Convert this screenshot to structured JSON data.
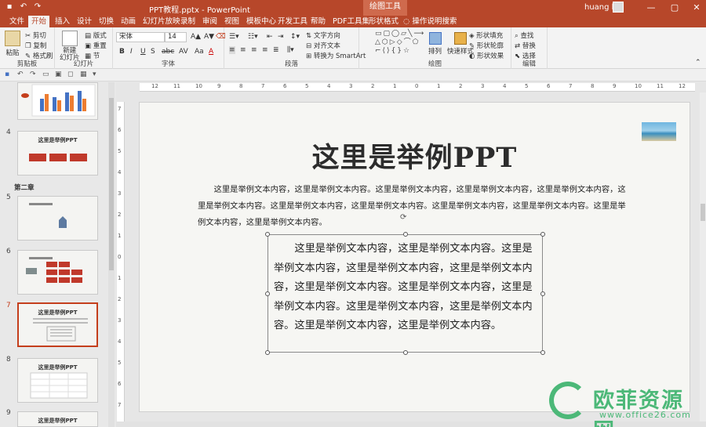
{
  "titlebar": {
    "doc_title": "PPT教程.pptx - PowerPoint",
    "context_group": "绘图工具",
    "user": "huang bo",
    "minimize": "—",
    "restore": "▢",
    "close": "✕"
  },
  "tabs": [
    "文件",
    "开始",
    "插入",
    "设计",
    "切换",
    "动画",
    "幻灯片放映",
    "录制",
    "审阅",
    "视图",
    "模板中心",
    "开发工具",
    "帮助",
    "PDF工具集",
    "形状格式"
  ],
  "tell_me": "操作说明搜索",
  "ribbon": {
    "clipboard": {
      "label": "剪贴板",
      "paste": "粘贴",
      "cut": "剪切",
      "copy": "复制",
      "format_painter": "格式刷"
    },
    "slides": {
      "label": "幻灯片",
      "new_slide": "新建\n幻灯片",
      "layout": "版式",
      "reset": "重置",
      "section": "节"
    },
    "font": {
      "label": "字体",
      "font_name": "宋体",
      "font_size": "14",
      "bold": "B",
      "italic": "I",
      "underline": "U",
      "strike": "S",
      "shadow": "abc",
      "spacing": "AV",
      "case": "Aa",
      "color": "A"
    },
    "paragraph": {
      "label": "段落",
      "text_direction": "文字方向",
      "align_text": "对齐文本",
      "smartart": "转换为 SmartArt"
    },
    "drawing": {
      "label": "绘图",
      "arrange": "排列",
      "quick_styles": "快速样式",
      "shape_fill": "形状填充",
      "shape_outline": "形状轮廓",
      "shape_effects": "形状效果"
    },
    "editing": {
      "label": "编辑",
      "find": "查找",
      "replace": "替换",
      "select": "选择"
    }
  },
  "thumbnails": [
    {
      "num": "4",
      "title": "这里是举例PPT"
    },
    {
      "num": "5",
      "title": ""
    },
    {
      "num": "6",
      "title": ""
    },
    {
      "num": "7",
      "title": "这里是举例PPT"
    },
    {
      "num": "8",
      "title": "这里是举例PPT"
    },
    {
      "num": "9",
      "title": "这里是举例PPT"
    }
  ],
  "section_label": "第二章",
  "ruler_h": [
    "12",
    "11",
    "10",
    "9",
    "8",
    "7",
    "6",
    "5",
    "4",
    "3",
    "2",
    "1",
    "0",
    "1",
    "2",
    "3",
    "4",
    "5",
    "6",
    "7",
    "8",
    "9",
    "10",
    "11",
    "12"
  ],
  "ruler_v": [
    "7",
    "6",
    "5",
    "4",
    "3",
    "2",
    "1",
    "0",
    "1",
    "2",
    "3",
    "4",
    "5",
    "6",
    "7"
  ],
  "slide": {
    "title": "这里是举例PPT",
    "paragraph": "这里是举例文本内容，这里是举例文本内容。这里是举例文本内容，这里是举例文本内容，这里是举例文本内容，这里是举例文本内容。这里是举例文本内容，这里是举例文本内容。这里是举例文本内容，这里是举例文本内容。这里是举例文本内容，这里是举例文本内容。",
    "textbox": "这里是举例文本内容，这里是举例文本内容。这里是举例文本内容，这里是举例文本内容，这里是举例文本内容，这里是举例文本内容。这里是举例文本内容，这里是举例文本内容。这里是举例文本内容，这里是举例文本内容。这里是举例文本内容，这里是举例文本内容。"
  },
  "watermark": {
    "name": "欧菲资源网",
    "url": "www.office26.com"
  },
  "colors": {
    "accent": "#b7472a",
    "watermark": "#4cb878"
  }
}
